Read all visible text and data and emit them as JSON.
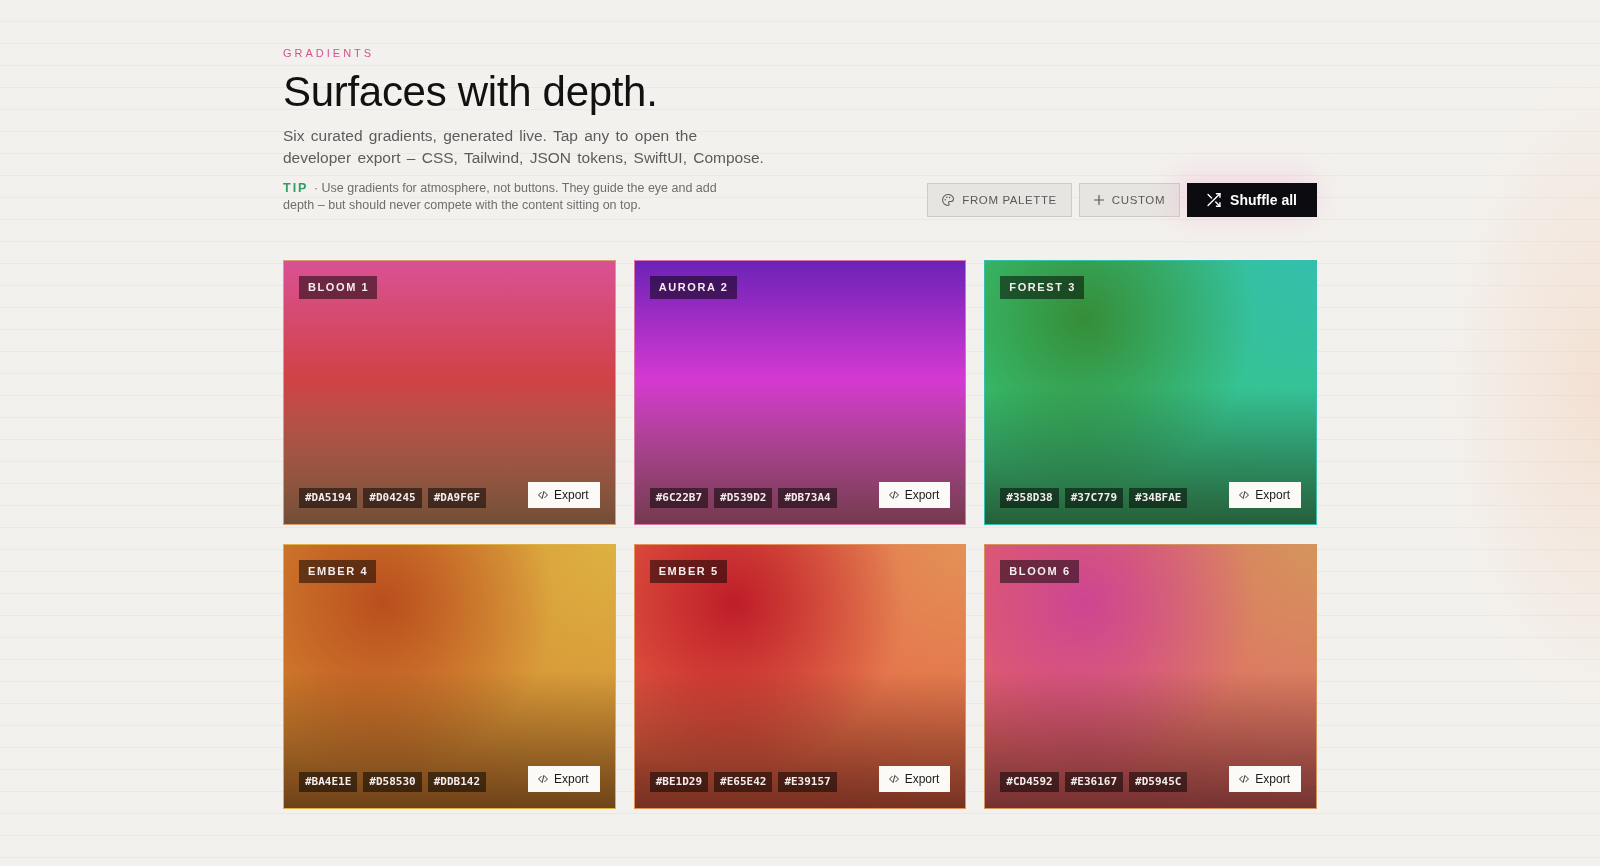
{
  "header": {
    "eyebrow": "GRADIENTS",
    "title": "Surfaces with depth.",
    "description": "Six curated gradients, generated live. Tap any to open the developer export – CSS, Tailwind, JSON tokens, SwiftUI, Compose.",
    "tip": "**TIP** · Use gradients for atmosphere, not buttons. They guide the eye and add depth – but should never compete with the content sitting on top."
  },
  "actions": [
    {
      "kind": "palette",
      "label": "FROM PALETTE"
    },
    {
      "kind": "custom",
      "label": "CUSTOM"
    },
    {
      "kind": "shuffle",
      "label": "Shuffle all"
    }
  ],
  "gradients": [
    {
      "name": "BLOOM 1",
      "kind": "linear",
      "stops": [
        {
          "hex": "#DA5194",
          "color": "#da5194"
        },
        {
          "hex": "#D04245",
          "color": "#d04245"
        },
        {
          "hex": "#DA9F6F",
          "color": "#da9f6f"
        }
      ],
      "export_button": "Export"
    },
    {
      "name": "AURORA 2",
      "kind": "linear",
      "stops": [
        {
          "hex": "#6C22B7",
          "color": "#6c22b7"
        },
        {
          "hex": "#D539D2",
          "color": "#d539d2"
        },
        {
          "hex": "#DB73A4",
          "color": "#db73a4"
        }
      ],
      "export_button": "Export"
    },
    {
      "name": "FOREST 3",
      "kind": "mesh",
      "stops": [
        {
          "hex": "#358D38",
          "color": "#358d38"
        },
        {
          "hex": "#37C779",
          "color": "#37c779"
        },
        {
          "hex": "#34BFAE",
          "color": "#34bfae"
        }
      ],
      "export_button": "Export"
    },
    {
      "name": "EMBER 4",
      "kind": "mesh",
      "stops": [
        {
          "hex": "#BA4E1E",
          "color": "#ba4e1e"
        },
        {
          "hex": "#D58530",
          "color": "#d58530"
        },
        {
          "hex": "#DDB142",
          "color": "#ddb142"
        }
      ],
      "export_button": "Export"
    },
    {
      "name": "EMBER 5",
      "kind": "mesh",
      "stops": [
        {
          "hex": "#BE1D29",
          "color": "#be1d29"
        },
        {
          "hex": "#E65E42",
          "color": "#e65e42"
        },
        {
          "hex": "#E39157",
          "color": "#e39157"
        }
      ],
      "export_button": "Export"
    },
    {
      "name": "BLOOM 6",
      "kind": "mesh",
      "stops": [
        {
          "hex": "#CD4592",
          "color": "#cd4592"
        },
        {
          "hex": "#E36167",
          "color": "#e36167"
        },
        {
          "hex": "#D5945C",
          "color": "#d5945c"
        }
      ],
      "export_button": "Export"
    }
  ]
}
